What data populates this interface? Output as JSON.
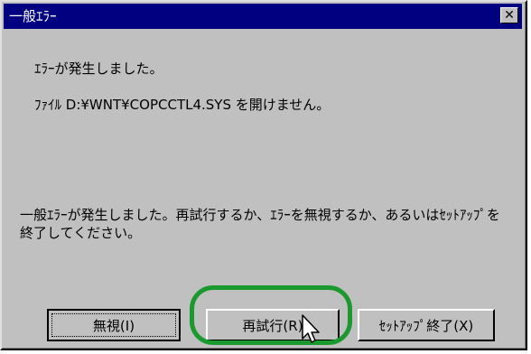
{
  "window": {
    "title": "一般ｴﾗｰ",
    "close_glyph": "✕"
  },
  "message": {
    "line1": "ｴﾗｰが発生しました。",
    "line2": "ﾌｧｲﾙ D:¥WNT¥COPCCTL4.SYS を開けません。",
    "line3": "一般ｴﾗｰが発生しました。再試行するか、ｴﾗｰを無視するか、あるいはｾｯﾄｱｯﾌﾟを終了してください。"
  },
  "buttons": {
    "ignore": "無視(I)",
    "retry": "再試行(R)",
    "exit_setup": "ｾｯﾄｱｯﾌﾟ終了(X)"
  },
  "colors": {
    "titlebar": "#000080",
    "dialog_face": "#c0c0c0",
    "highlight": "#1a9a2e"
  },
  "icons": {
    "cursor": "arrow-pointer-icon",
    "close": "close-icon"
  }
}
